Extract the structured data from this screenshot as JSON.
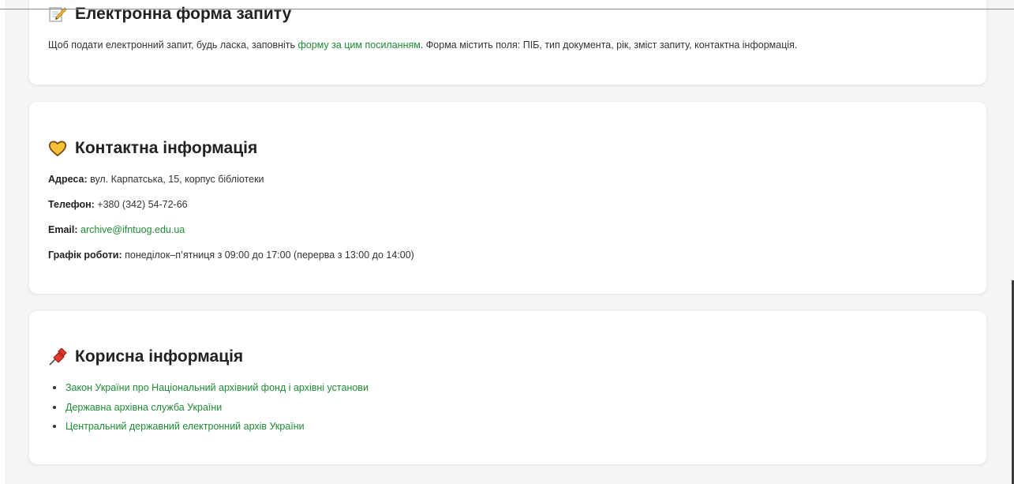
{
  "form_section": {
    "icon": "memo-icon",
    "title": "Електронна форма запиту",
    "text_before": "Щоб подати електронний запит, будь ласка, заповніть ",
    "link_text": "форму за цим посиланням",
    "text_after": ". Форма містить поля: ПІБ, тип документа, рік, зміст запиту, контактна інформація."
  },
  "contact_section": {
    "icon": "yellow-heart-icon",
    "title": "Контактна інформація",
    "address_label": "Адреса:",
    "address_value": " вул. Карпатська, 15, корпус бібліотеки",
    "phone_label": "Телефон:",
    "phone_value": " +380 (342) 54-72-66",
    "email_label": "Email:",
    "email_value": "archive@ifntuog.edu.ua",
    "hours_label": "Графік роботи:",
    "hours_value": " понеділок–п’ятниця з 09:00 до 17:00 (перерва з 13:00 до 14:00)"
  },
  "useful_section": {
    "icon": "pushpin-icon",
    "title": "Корисна інформація",
    "links": [
      "Закон України про Національний архівний фонд і архівні установи",
      "Державна архівна служба України",
      "Центральний державний електронний архів України"
    ]
  },
  "colors": {
    "link": "#1e8c35",
    "background": "#f4f5f6",
    "card": "#ffffff"
  }
}
